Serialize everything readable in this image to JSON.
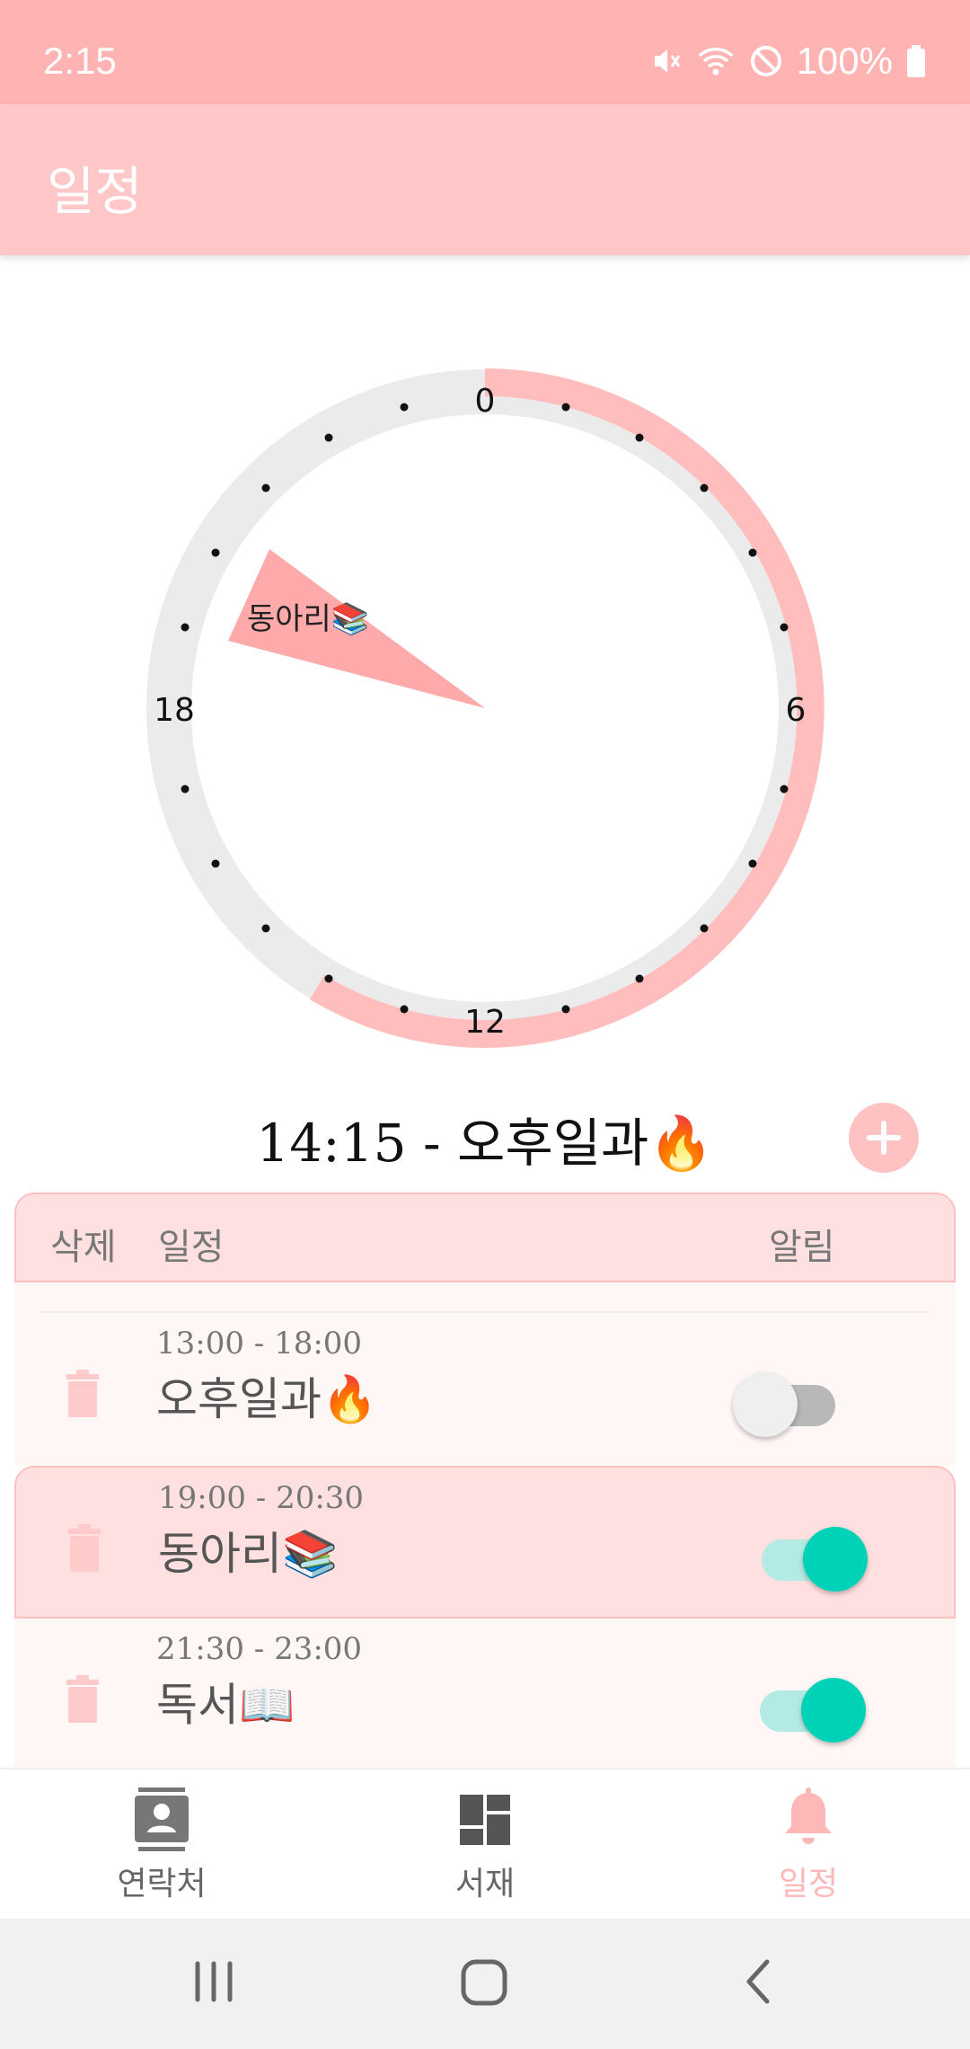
{
  "status_bar": {
    "time": "2:15",
    "battery": "100%"
  },
  "app_bar": {
    "title": "일정"
  },
  "clock": {
    "labels": {
      "top": "0",
      "right": "6",
      "bottom": "12",
      "left": "18"
    },
    "sector_label": "동아리📚",
    "colors": {
      "ring": "#ebebeb",
      "arc": "#ffbdbd",
      "sector": "#ffaaaa"
    }
  },
  "current": {
    "text": "14:15 - 오후일과🔥"
  },
  "table": {
    "headers": {
      "delete": "삭제",
      "schedule": "일정",
      "alarm": "알림"
    },
    "rows": [
      {
        "time": "13:00 - 18:00",
        "title": "오후일과🔥",
        "alarm": false
      },
      {
        "time": "19:00 - 20:30",
        "title": "동아리📚",
        "alarm": true
      },
      {
        "time": "21:30 - 23:00",
        "title": "독서📖",
        "alarm": true
      }
    ]
  },
  "bottom_nav": {
    "items": [
      {
        "label": "연락처",
        "icon": "contact-icon"
      },
      {
        "label": "서재",
        "icon": "dashboard-icon"
      },
      {
        "label": "일정",
        "icon": "bell-icon"
      }
    ]
  },
  "system_nav": {
    "icons": [
      "recents-icon",
      "home-icon",
      "back-icon"
    ]
  }
}
